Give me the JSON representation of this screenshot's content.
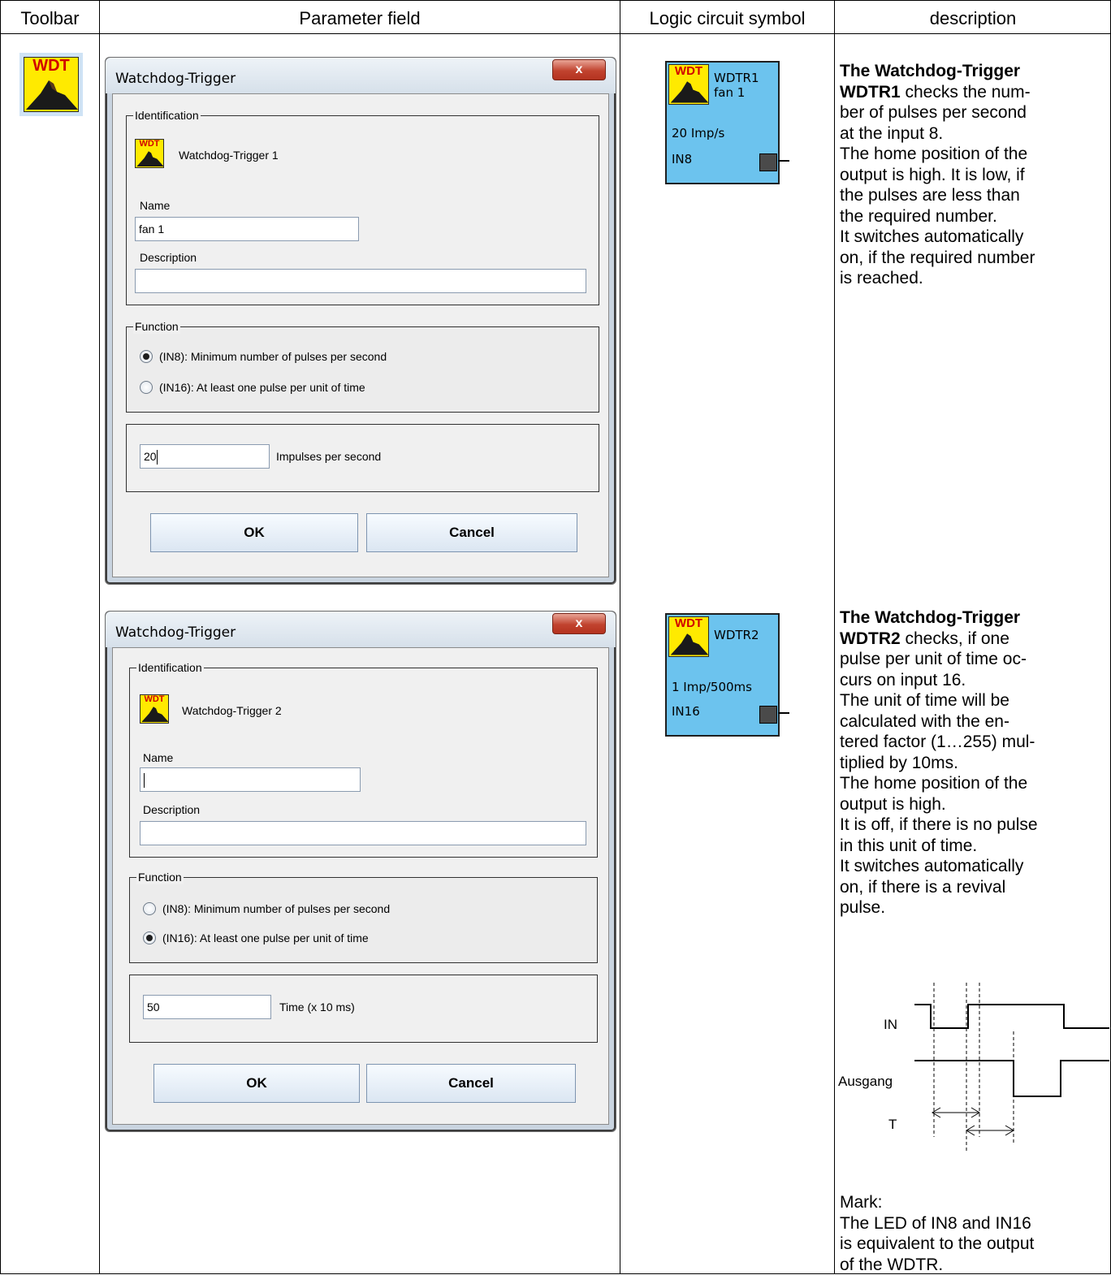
{
  "table": {
    "headers": {
      "toolbar": "Toolbar",
      "parameter_field": "Parameter field",
      "logic_symbol": "Logic circuit symbol",
      "description": "description"
    }
  },
  "toolbar_icon": {
    "icon": "watchdog-trigger-icon",
    "text": "WDT"
  },
  "dialog1": {
    "title": "Watchdog-Trigger",
    "close_label": "x",
    "identification_legend": "Identification",
    "block_name": "Watchdog-Trigger 1",
    "name_label": "Name",
    "name_value": "fan 1",
    "description_label": "Description",
    "description_value": "",
    "function_legend": "Function",
    "option1": "(IN8): Minimum number of pulses per second",
    "option2": "(IN16): At least one pulse per unit of time",
    "selected_option": 1,
    "value": "20",
    "value_unit": "Impulses per second",
    "ok_label": "OK",
    "cancel_label": "Cancel"
  },
  "dialog2": {
    "title": "Watchdog-Trigger",
    "close_label": "x",
    "identification_legend": "Identification",
    "block_name": "Watchdog-Trigger 2",
    "name_label": "Name",
    "name_value": "",
    "description_label": "Description",
    "description_value": "",
    "function_legend": "Function",
    "option1": "(IN8): Minimum number of pulses per second",
    "option2": "(IN16): At least one pulse per unit of time",
    "selected_option": 2,
    "value": "50",
    "value_unit": "Time (x 10 ms)",
    "ok_label": "OK",
    "cancel_label": "Cancel"
  },
  "symbol1": {
    "name": "WDTR1",
    "sub": "fan 1",
    "rate": "20 Imp/s",
    "input": "IN8",
    "icon_text": "WDT"
  },
  "symbol2": {
    "name": "WDTR2",
    "sub": "",
    "rate": "1 Imp/500ms",
    "input": "IN16",
    "icon_text": "WDT"
  },
  "desc1": {
    "lead": "The Watchdog-Trigger",
    "name": "WDTR1",
    "line1": " checks the num-",
    "lines": [
      "ber of pulses per second",
      "at the input 8.",
      "The home position of the",
      "output is high. It is low, if",
      "the pulses are less than",
      "the required number.",
      "It switches automatically",
      "on, if the required number",
      "is reached."
    ]
  },
  "desc2": {
    "lead": "The Watchdog-Trigger",
    "name": "WDTR2",
    "line1": " checks, if one",
    "lines": [
      "pulse per unit of time oc-",
      "curs on input 16.",
      "The unit of time will be",
      "calculated with the en-",
      "tered factor (1…255) mul-",
      "tiplied by 10ms.",
      "The home position of the",
      "output is high.",
      "It is off, if there is no pulse",
      "in this unit of time.",
      "It switches automatically",
      "on, if there is a revival",
      "pulse."
    ]
  },
  "timing": {
    "in_label": "IN",
    "out_label": "Ausgang",
    "t_label": "T"
  },
  "mark": {
    "title": "Mark:",
    "lines": [
      "The LED of IN8 and IN16",
      "is equivalent to the output",
      "of the WDTR."
    ]
  },
  "colors": {
    "icon_yellow": "#ffea00",
    "icon_red": "#d00000",
    "symbol_blue": "#6cc3ee",
    "close_red": "#c1432f"
  }
}
